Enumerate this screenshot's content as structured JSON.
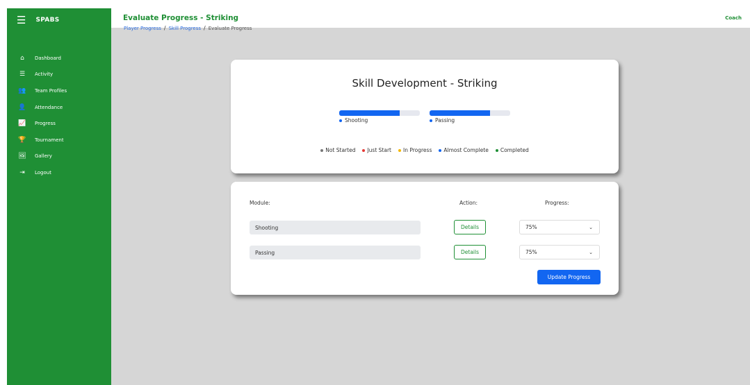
{
  "app": {
    "brand": "SPABS",
    "menu_icon": "hamburger-icon"
  },
  "sidebar": {
    "items": [
      {
        "label": "Dashboard",
        "icon": "home-icon",
        "glyph": "⌂"
      },
      {
        "label": "Activity",
        "icon": "list-icon",
        "glyph": "☰"
      },
      {
        "label": "Team Profiles",
        "icon": "users-icon",
        "glyph": "👥"
      },
      {
        "label": "Attendance",
        "icon": "user-check-icon",
        "glyph": "👤"
      },
      {
        "label": "Progress",
        "icon": "chart-line-icon",
        "glyph": "📈"
      },
      {
        "label": "Tournament",
        "icon": "trophy-icon",
        "glyph": "🏆"
      },
      {
        "label": "Gallery",
        "icon": "images-icon",
        "glyph": "🖼"
      },
      {
        "label": "Logout",
        "icon": "logout-icon",
        "glyph": "⇥"
      }
    ]
  },
  "header": {
    "title": "Evaluate Progress - Striking",
    "role": "Coach"
  },
  "breadcrumb": {
    "items": [
      "Player Progress",
      "Skill Progress",
      "Evaluate Progress"
    ],
    "separator": "/"
  },
  "summary": {
    "title": "Skill Development - Striking",
    "skills": [
      {
        "name": "Shooting",
        "progress": 0.75
      },
      {
        "name": "Passing",
        "progress": 0.75
      }
    ],
    "legend": [
      {
        "label": "Not Started",
        "color": "#777777"
      },
      {
        "label": "Just Start",
        "color": "#e53935"
      },
      {
        "label": "In Progress",
        "color": "#f5b800"
      },
      {
        "label": "Almost Complete",
        "color": "#1266f1"
      },
      {
        "label": "Completed",
        "color": "#1f8f35"
      }
    ]
  },
  "form": {
    "headers": {
      "module": "Module:",
      "action": "Action:",
      "progress": "Progress:"
    },
    "rows": [
      {
        "module": "Shooting",
        "action": "Details",
        "progress": "75%"
      },
      {
        "module": "Passing",
        "action": "Details",
        "progress": "75%"
      }
    ],
    "submit": "Update Progress"
  },
  "colors": {
    "sidebar": "#1f8f35",
    "primary": "#1266f1",
    "background": "#d6d6d6"
  }
}
